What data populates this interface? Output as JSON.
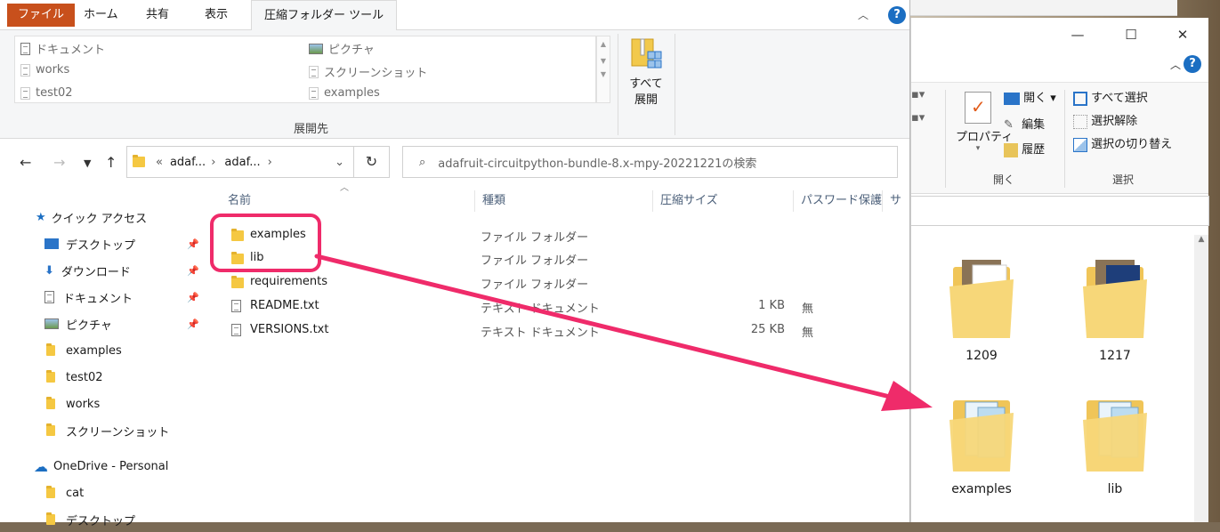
{
  "explorer": {
    "tabs": {
      "file": "ファイル",
      "home": "ホーム",
      "share": "共有",
      "view": "表示",
      "compressed_tools": "圧縮フォルダー ツール"
    },
    "ribbon": {
      "destinations": [
        "ドキュメント",
        "works",
        "test02",
        "ピクチャ",
        "スクリーンショット",
        "examples"
      ],
      "group_label": "展開先",
      "extract_all": [
        "すべて",
        "展開"
      ]
    },
    "address": {
      "crumb1": "adaf...",
      "crumb2": "adaf...",
      "prefix": "«",
      "search_placeholder": "adafruit-circuitpython-bundle-8.x-mpy-20221221の検索"
    },
    "nav": [
      {
        "label": "クイック アクセス",
        "icon": "star-icon",
        "pinned": false
      },
      {
        "label": "デスクトップ",
        "icon": "desktop-icon",
        "pinned": true
      },
      {
        "label": "ダウンロード",
        "icon": "download-icon",
        "pinned": true
      },
      {
        "label": "ドキュメント",
        "icon": "document-icon",
        "pinned": true
      },
      {
        "label": "ピクチャ",
        "icon": "picture-icon",
        "pinned": true
      },
      {
        "label": "examples",
        "icon": "folder-icon",
        "pinned": false
      },
      {
        "label": "test02",
        "icon": "folder-icon",
        "pinned": false
      },
      {
        "label": "works",
        "icon": "folder-icon",
        "pinned": false
      },
      {
        "label": "スクリーンショット",
        "icon": "folder-icon",
        "pinned": false
      },
      {
        "label": "OneDrive - Personal",
        "icon": "cloud-icon",
        "pinned": false
      },
      {
        "label": "cat",
        "icon": "folder-icon",
        "pinned": false
      },
      {
        "label": "デスクトップ",
        "icon": "folder-icon",
        "pinned": false
      }
    ],
    "columns": [
      "名前",
      "種類",
      "圧縮サイズ",
      "パスワード保護",
      "サイ"
    ],
    "files": [
      {
        "name": "examples",
        "type": "ファイル フォルダー",
        "size": "",
        "pw": "",
        "icon": "folder"
      },
      {
        "name": "lib",
        "type": "ファイル フォルダー",
        "size": "",
        "pw": "",
        "icon": "folder"
      },
      {
        "name": "requirements",
        "type": "ファイル フォルダー",
        "size": "",
        "pw": "",
        "icon": "folder"
      },
      {
        "name": "README.txt",
        "type": "テキスト ドキュメント",
        "size": "1 KB",
        "pw": "無",
        "icon": "doc"
      },
      {
        "name": "VERSIONS.txt",
        "type": "テキスト ドキュメント",
        "size": "25 KB",
        "pw": "無",
        "icon": "doc"
      }
    ]
  },
  "second_window": {
    "ribbon": {
      "properties": "プロパティ",
      "open": "開く",
      "edit": "編集",
      "history": "履歴",
      "open_group": "開く",
      "select_all": "すべて選択",
      "select_none": "選択解除",
      "invert": "選択の切り替え",
      "select_group": "選択"
    },
    "tiles": [
      "1209",
      "1217",
      "examples",
      "lib"
    ]
  },
  "colors": {
    "file_tab": "#c8501c",
    "highlight": "#ef2b6a",
    "folder": "#f5c842"
  }
}
